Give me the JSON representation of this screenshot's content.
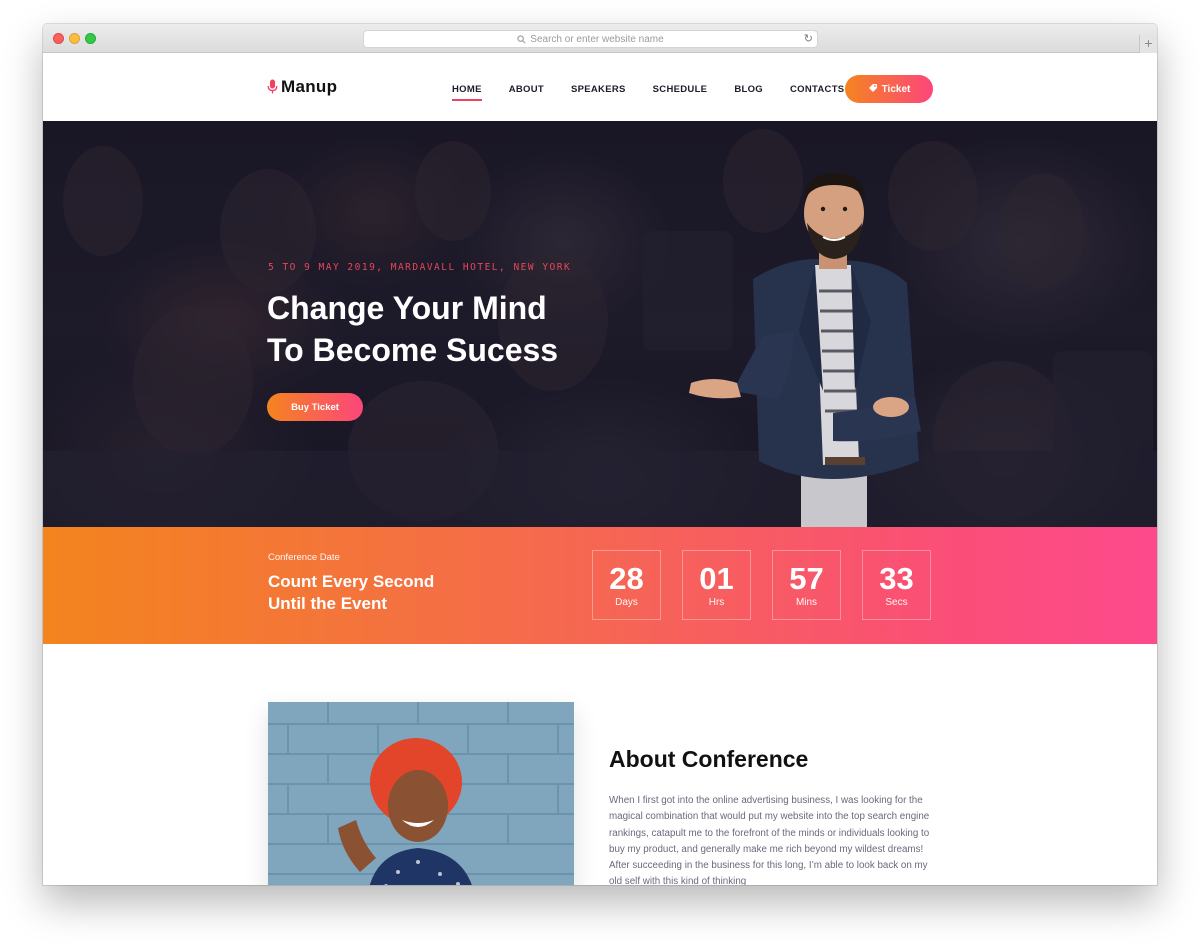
{
  "browser": {
    "url_placeholder": "Search or enter website name",
    "new_tab": "+"
  },
  "brand": {
    "name": "Manup",
    "accent": "#f43f5e"
  },
  "nav": {
    "links": [
      "HOME",
      "ABOUT",
      "SPEAKERS",
      "SCHEDULE",
      "BLOG",
      "CONTACTS"
    ],
    "active": "HOME",
    "ticket_label": "Ticket"
  },
  "hero": {
    "date_location": "5 TO 9 MAY 2019, MARDAVALL HOTEL, NEW YORK",
    "title_line1": "Change Your Mind",
    "title_line2": "To Become Sucess",
    "button_label": "Buy Ticket"
  },
  "countdown": {
    "kicker": "Conference Date",
    "title_line1": "Count Every Second",
    "title_line2": "Until the Event",
    "units": [
      {
        "value": "28",
        "label": "Days"
      },
      {
        "value": "01",
        "label": "Hrs"
      },
      {
        "value": "57",
        "label": "Mins"
      },
      {
        "value": "33",
        "label": "Secs"
      }
    ],
    "gradient": [
      "#f3841e",
      "#fd4a8c"
    ]
  },
  "about": {
    "title": "About Conference",
    "body": "When I first got into the online advertising business, I was looking for the magical combination that would put my website into the top search engine rankings, catapult me to the forefront of the minds or individuals looking to buy my product, and generally make me rich beyond my wildest dreams! After succeeding in the business for this long, I’m able to look back on my old self with this kind of thinking"
  }
}
